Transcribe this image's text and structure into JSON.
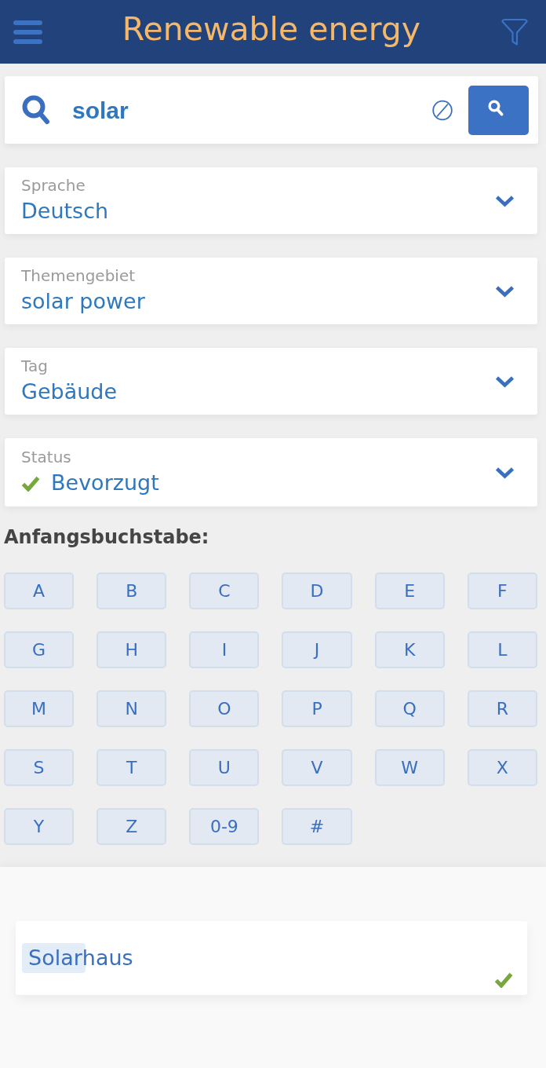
{
  "header": {
    "title": "Renewable energy"
  },
  "search": {
    "value": "solar"
  },
  "filters": [
    {
      "kind": "select",
      "label": "Sprache",
      "value": "Deutsch"
    },
    {
      "kind": "select",
      "label": "Themengebiet",
      "value": "solar power"
    },
    {
      "kind": "select",
      "label": "Tag",
      "value": "Gebäude"
    },
    {
      "kind": "status",
      "label": "Status",
      "value": "Bevorzugt"
    }
  ],
  "letter_filter": {
    "heading": "Anfangsbuchstabe:",
    "letters": [
      {
        "label": "A",
        "selected": false
      },
      {
        "label": "B",
        "selected": false
      },
      {
        "label": "C",
        "selected": false
      },
      {
        "label": "D",
        "selected": false
      },
      {
        "label": "E",
        "selected": false
      },
      {
        "label": "F",
        "selected": false
      },
      {
        "label": "G",
        "selected": false
      },
      {
        "label": "H",
        "selected": false
      },
      {
        "label": "I",
        "selected": false
      },
      {
        "label": "J",
        "selected": false
      },
      {
        "label": "K",
        "selected": false
      },
      {
        "label": "L",
        "selected": false
      },
      {
        "label": "M",
        "selected": false
      },
      {
        "label": "N",
        "selected": false
      },
      {
        "label": "O",
        "selected": false
      },
      {
        "label": "P",
        "selected": false
      },
      {
        "label": "Q",
        "selected": false
      },
      {
        "label": "R",
        "selected": false
      },
      {
        "label": "S",
        "selected": false
      },
      {
        "label": "T",
        "selected": false
      },
      {
        "label": "U",
        "selected": false
      },
      {
        "label": "V",
        "selected": false
      },
      {
        "label": "W",
        "selected": false
      },
      {
        "label": "X",
        "selected": false
      },
      {
        "label": "Y",
        "selected": false
      },
      {
        "label": "Z",
        "selected": false
      },
      {
        "label": "0-9",
        "selected": false
      },
      {
        "label": "#",
        "selected": false
      }
    ]
  },
  "results": [
    {
      "title_parts": [
        {
          "text": "Solar",
          "highlighted": true
        },
        {
          "text": "haus",
          "highlighted": false
        }
      ],
      "preferred": true
    }
  ]
}
